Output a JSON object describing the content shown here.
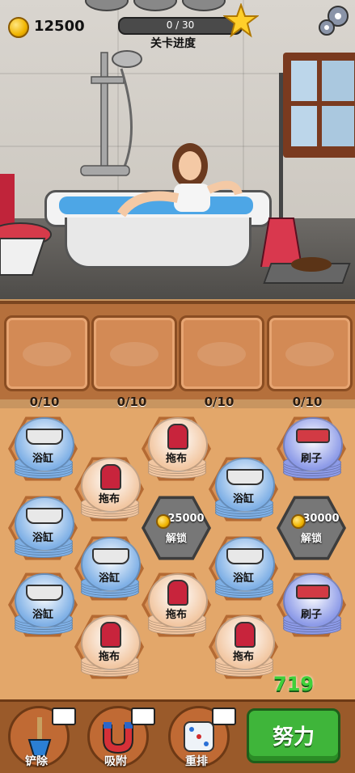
{
  "hud": {
    "coins": "12500",
    "progress_text": "0 / 30",
    "progress_label": "关卡进度",
    "progress_fraction": 0
  },
  "icons": {
    "coin": "coin-icon",
    "star": "star-icon",
    "settings": "gear-icon",
    "video": "video-icon"
  },
  "slots_counts": [
    "0/10",
    "0/10",
    "0/10",
    "0/10"
  ],
  "tiles": {
    "bathtub": "浴缸",
    "mop": "拖布",
    "brush": "刷子"
  },
  "locked": [
    {
      "cost": "25000",
      "label": "解锁"
    },
    {
      "cost": "30000",
      "label": "解锁"
    }
  ],
  "moves_left": "719",
  "tools": [
    {
      "label": "铲除"
    },
    {
      "label": "吸附"
    },
    {
      "label": "重排"
    }
  ],
  "action_button": "努力",
  "colors": {
    "bathtub_disc": "#7fb0e6",
    "mop_disc": "#f2c7a2",
    "brush_disc": "#8d9be8",
    "green_button": "#3fb53a"
  }
}
